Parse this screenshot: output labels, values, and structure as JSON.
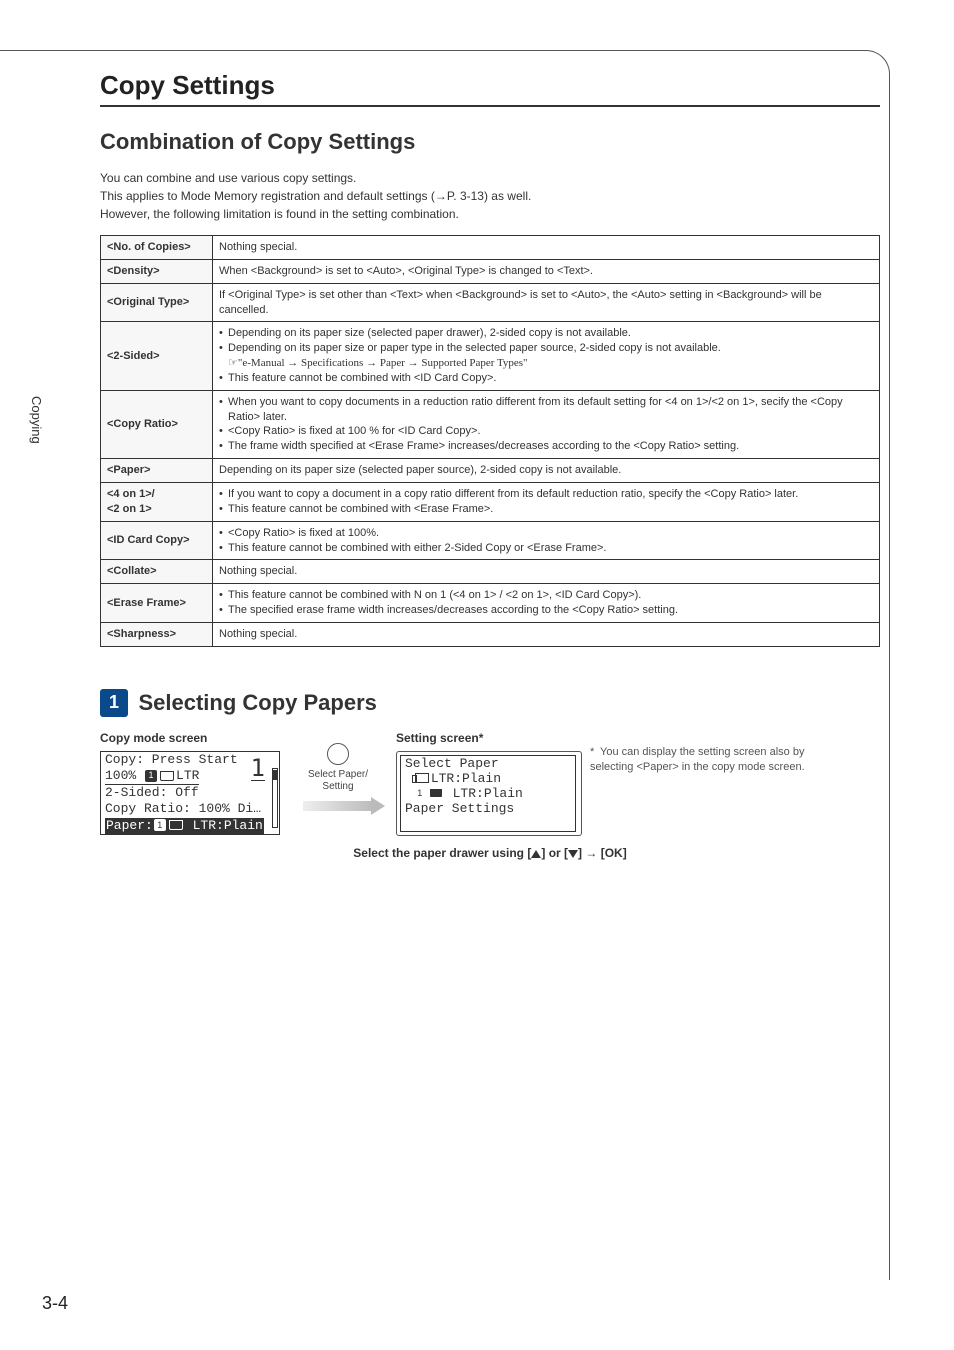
{
  "side_tab": "Copying",
  "page_number": "3-4",
  "title": "Copy Settings",
  "subtitle": "Combination of Copy Settings",
  "intro_lines": [
    "You can combine and use various copy settings.",
    "This applies to Mode Memory registration and default settings (→P. 3-13) as well.",
    "However, the following limitation is found in the setting combination."
  ],
  "rows": {
    "no_of_copies": {
      "label": "<No. of Copies>",
      "text": "Nothing special."
    },
    "density": {
      "label": "<Density>",
      "text": "When <Background> is set to <Auto>, <Original Type> is changed to <Text>."
    },
    "original_type": {
      "label": "<Original Type>",
      "text": "If <Original Type> is set other than <Text> when <Background> is set to <Auto>, the <Auto> setting in <Background> will be cancelled."
    },
    "two_sided": {
      "label": "<2-Sided>",
      "b1": "Depending on its paper size (selected paper drawer), 2-sided copy is not available.",
      "b2": "Depending on its paper size or paper type in the selected paper source, 2-sided copy is not available.",
      "b2sub": "\"e-Manual → Specifications → Paper → Supported Paper Types\"",
      "b3": "This feature cannot be combined with <ID Card Copy>."
    },
    "copy_ratio": {
      "label": "<Copy Ratio>",
      "b1": "When you want to copy documents in a reduction ratio different from its default setting for <4 on 1>/<2 on 1>, secify the <Copy Ratio> later.",
      "b2": "<Copy Ratio> is fixed at 100 % for <ID Card Copy>.",
      "b3": "The frame width specified at <Erase Frame> increases/decreases according to the <Copy Ratio> setting."
    },
    "paper": {
      "label": "<Paper>",
      "text": "Depending on its paper size (selected paper source), 2-sided copy is not available."
    },
    "n_on_1": {
      "label1": "<4 on 1>/",
      "label2": "<2 on 1>",
      "b1": "If you want to copy a document in a copy ratio different from its default reduction ratio, specify the <Copy Ratio> later.",
      "b2": "This feature cannot be combined with <Erase Frame>."
    },
    "id_card": {
      "label": "<ID Card Copy>",
      "b1": "<Copy Ratio> is fixed at 100%.",
      "b2": "This feature cannot be combined with either 2-Sided Copy or <Erase Frame>."
    },
    "collate": {
      "label": "<Collate>",
      "text": "Nothing special."
    },
    "erase_frame": {
      "label": "<Erase Frame>",
      "b1": "This feature cannot be combined with N on 1 (<4 on 1> / <2 on 1>, <ID Card Copy>).",
      "b2": "The specified erase frame width increases/decreases according to the <Copy Ratio> setting."
    },
    "sharpness": {
      "label": "<Sharpness>",
      "text": "Nothing special."
    }
  },
  "section2": {
    "num": "1",
    "title": "Selecting Copy Papers",
    "left_label": "Copy mode screen",
    "right_label": "Setting screen*",
    "lcd1": {
      "l1": "Copy: Press Start",
      "l2a": "100%",
      "l2b": "LTR",
      "big": "1",
      "l3": "2-Sided: Off",
      "l4": "Copy Ratio: 100% Di…",
      "l5a": "Paper:",
      "l5b": " LTR:Plain"
    },
    "mid": {
      "btn": "Select Paper/\nSetting"
    },
    "lcd2": {
      "l1": "Select Paper",
      "l2": " LTR:Plain",
      "l3": " LTR:Plain",
      "l4": " Paper Settings"
    },
    "note": "You can display the setting screen also by selecting <Paper> in the copy mode screen.",
    "instruction_pre": "Select the paper drawer using [",
    "instruction_mid": "] or [",
    "instruction_post": "] → [OK]"
  }
}
